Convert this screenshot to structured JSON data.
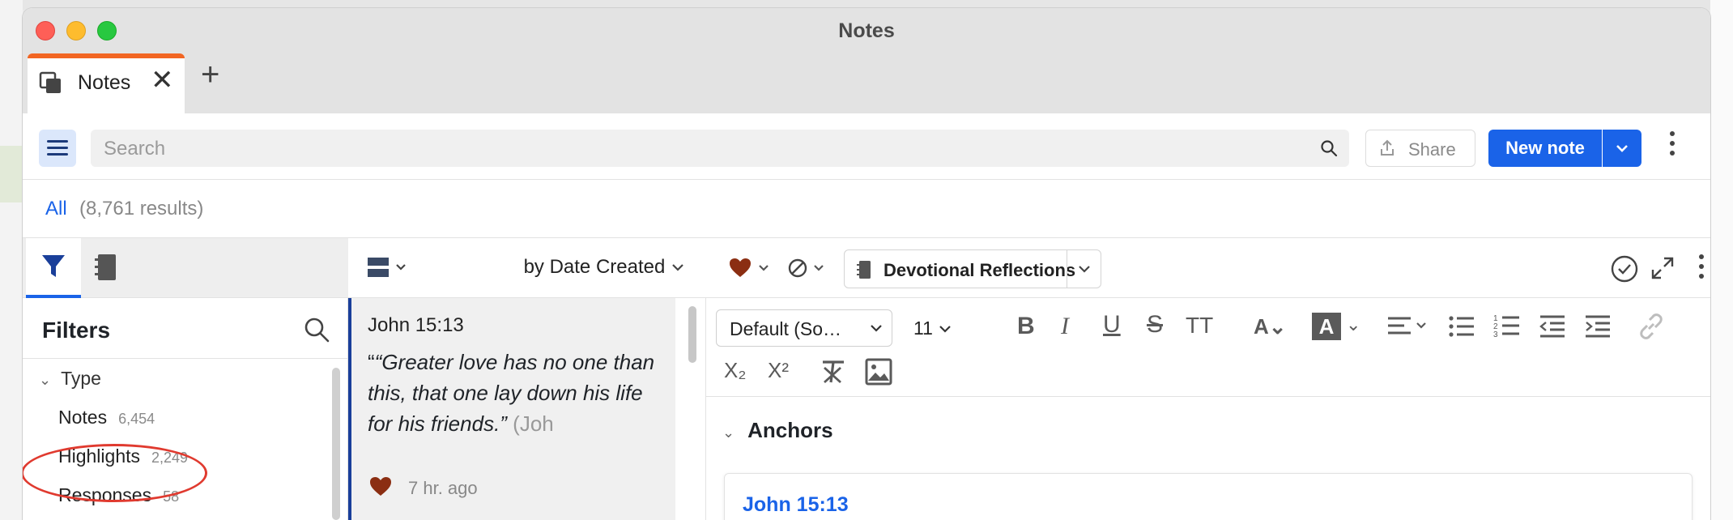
{
  "window": {
    "title": "Notes"
  },
  "tab": {
    "label": "Notes",
    "close": "✕",
    "add": "+"
  },
  "toolbar": {
    "search_placeholder": "Search",
    "share_label": "Share",
    "new_note_label": "New note"
  },
  "results": {
    "all_label": "All",
    "count_label": "(8,761 results)"
  },
  "filters": {
    "title": "Filters",
    "group_label": "Type",
    "items": [
      {
        "label": "Notes",
        "count": "6,454"
      },
      {
        "label": "Highlights",
        "count": "2,249"
      },
      {
        "label": "Responses",
        "count": "58"
      }
    ]
  },
  "list": {
    "sort_label": "by Date Created",
    "card": {
      "reference": "John 15:13",
      "quote_open": "“",
      "quote_text": "“Greater love has no one than this, that one lay down his life for his friends.”",
      "quote_tail": " (Joh",
      "time_ago": "7 hr. ago"
    }
  },
  "editor": {
    "notebook_label": "Devotional Reflections",
    "font_label": "Default (So…",
    "font_size": "11",
    "anchors_label": "Anchors",
    "anchor_reference": "John 15:13"
  },
  "colors": {
    "accent": "#1a63e8",
    "tab_top": "#f26522",
    "heart": "#8b2e12",
    "circle": "#e03a2f"
  }
}
